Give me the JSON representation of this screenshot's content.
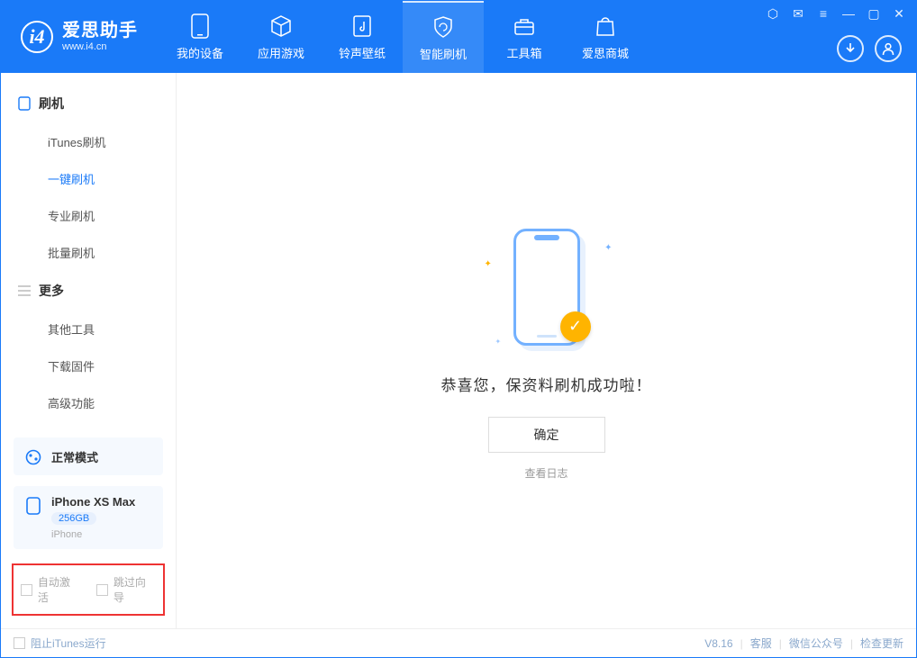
{
  "brand": {
    "name": "爱思助手",
    "url": "www.i4.cn"
  },
  "nav": {
    "my_device": "我的设备",
    "apps_games": "应用游戏",
    "ring_wall": "铃声壁纸",
    "smart_flash": "智能刷机",
    "toolbox": "工具箱",
    "store": "爱思商城"
  },
  "sidebar": {
    "group_flash": "刷机",
    "items_flash": {
      "itunes": "iTunes刷机",
      "onekey": "一键刷机",
      "pro": "专业刷机",
      "batch": "批量刷机"
    },
    "group_more": "更多",
    "items_more": {
      "other_tools": "其他工具",
      "download_fw": "下载固件",
      "advanced": "高级功能"
    },
    "mode_card": {
      "title": "正常模式"
    },
    "device_card": {
      "name": "iPhone XS Max",
      "capacity": "256GB",
      "type": "iPhone"
    },
    "cb_auto_activate": "自动激活",
    "cb_skip_guide": "跳过向导"
  },
  "main": {
    "success": "恭喜您，保资料刷机成功啦！",
    "ok": "确定",
    "view_log": "查看日志"
  },
  "footer": {
    "block_itunes": "阻止iTunes运行",
    "version": "V8.16",
    "support": "客服",
    "wechat": "微信公众号",
    "check_update": "检查更新"
  }
}
